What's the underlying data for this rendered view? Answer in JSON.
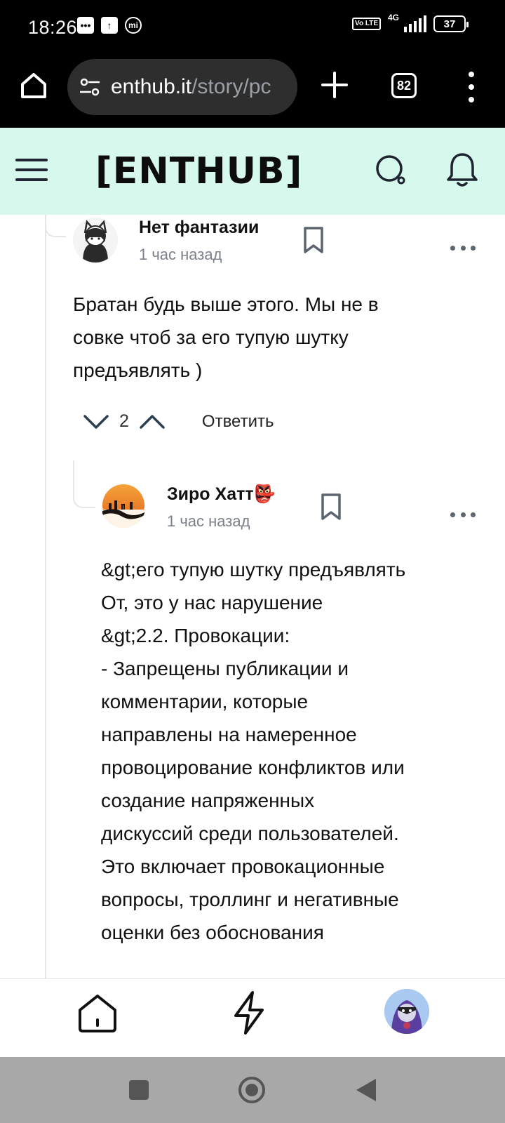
{
  "status_bar": {
    "time": "18:26",
    "network": "4G",
    "volte": "Vo LTE",
    "battery": "37"
  },
  "browser": {
    "url_host": "enthub.it",
    "url_path": "/story/pc",
    "tab_count": "82"
  },
  "site": {
    "logo": "[ENTHUB]"
  },
  "comments": [
    {
      "author": "Нет фантазии",
      "time": "1 час назад",
      "text_lines": [
        "Братан будь выше этого. Мы не в",
        "совке чтоб за его тупую шутку",
        "предъявлять )"
      ],
      "votes": "2",
      "reply_label": "Ответить"
    },
    {
      "author": "Зиро Хатт👺",
      "time": "1 час назад",
      "text_lines": [
        "&gt;его тупую шутку предъявлять",
        "От, это у нас нарушение",
        "&gt;2.2. Провокации:",
        "- Запрещены публикации и",
        "комментарии, которые",
        "направлены на намеренное",
        "провоцирование конфликтов или",
        "создание напряженных",
        "дискуссий среди пользователей.",
        "Это включает провокационные",
        "вопросы, троллинг и негативные",
        "оценки без обоснования"
      ]
    }
  ],
  "colors": {
    "header_bg": "#d7f8ed",
    "thread_line": "#e4e6ea",
    "muted_text": "#7a8089"
  }
}
